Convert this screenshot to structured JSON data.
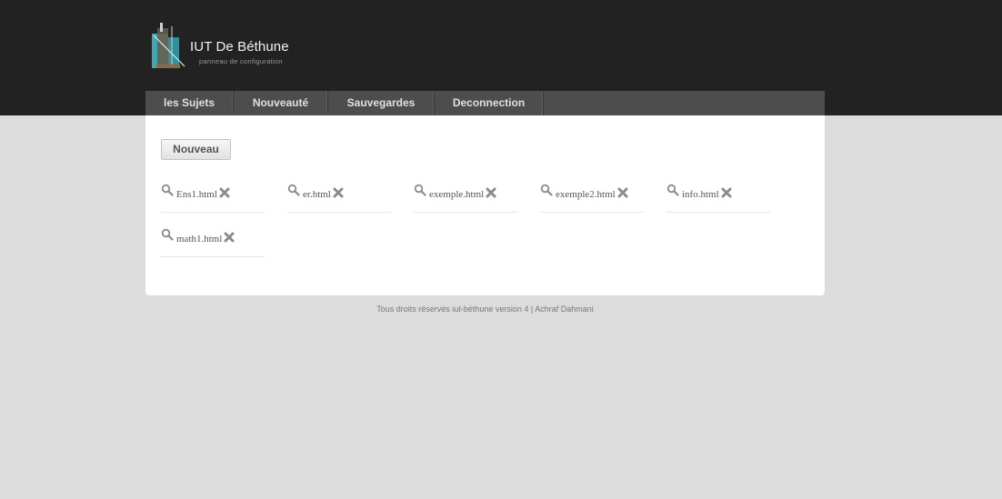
{
  "brand": {
    "title": "IUT De Béthune",
    "subtitle": "panneau de configuration"
  },
  "nav": {
    "items": [
      {
        "label": "les Sujets"
      },
      {
        "label": "Nouveauté"
      },
      {
        "label": "Sauvegardes"
      },
      {
        "label": "Deconnection"
      }
    ]
  },
  "toolbar": {
    "new_label": "Nouveau"
  },
  "files": [
    {
      "name": "Ens1.html"
    },
    {
      "name": "er.html"
    },
    {
      "name": "exemple.html"
    },
    {
      "name": "exemple2.html"
    },
    {
      "name": "info.html"
    },
    {
      "name": "math1.html"
    }
  ],
  "footer": {
    "text": "Tous droits réservés iut-béthune version 4 | Achraf Dahmani"
  },
  "colors": {
    "header_bg": "#222222",
    "nav_bg": "#4d4d4d",
    "page_bg": "#dcdcdc",
    "panel_bg": "#ffffff",
    "icon_gray": "#8c8c8c"
  },
  "icons": {
    "view": "search-icon",
    "delete": "close-icon",
    "logo": "belfry-logo-icon"
  }
}
